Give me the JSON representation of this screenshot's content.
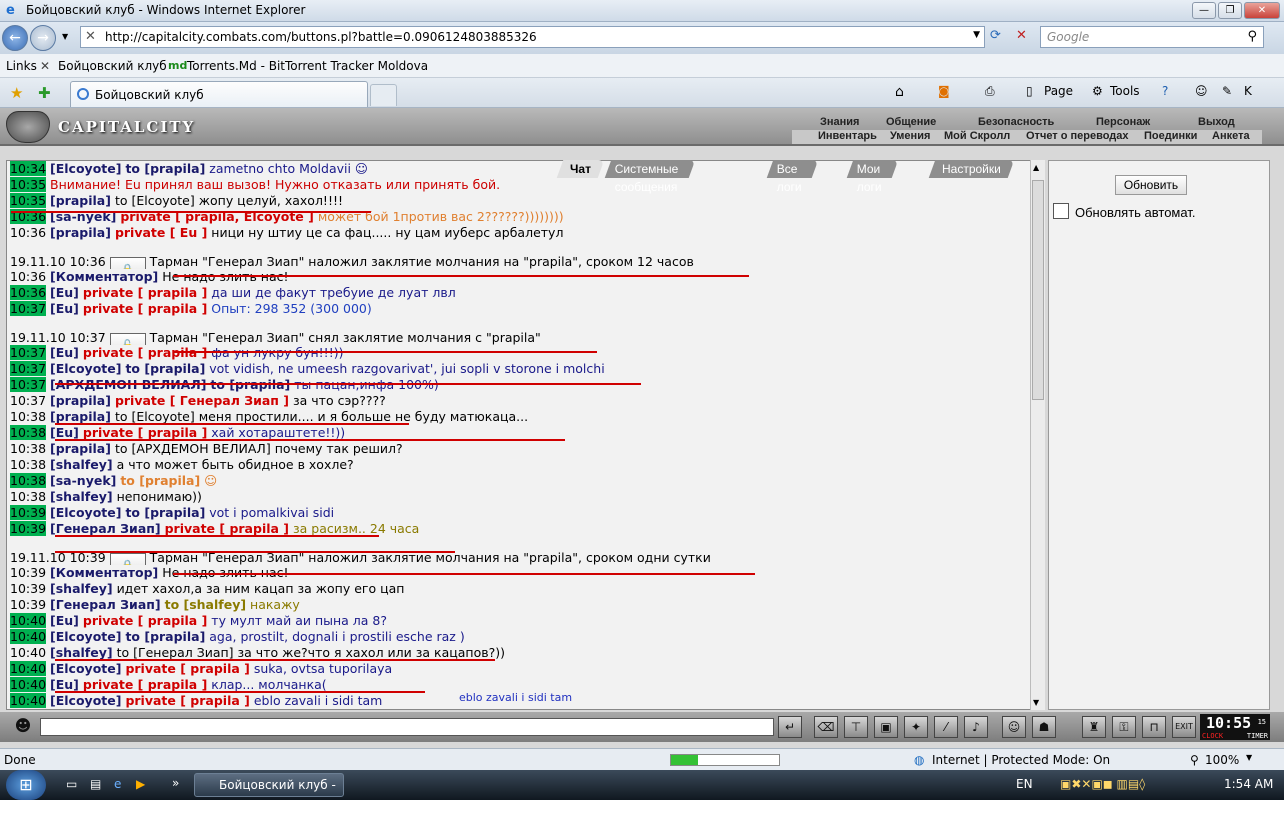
{
  "window": {
    "title": "Бойцовский клуб - Windows Internet Explorer"
  },
  "address": {
    "url": "http://capitalcity.combats.com/buttons.pl?battle=0.0906124803885326",
    "search_placeholder": "Google"
  },
  "links_bar": {
    "label": "Links",
    "items": [
      "Бойцовский клуб",
      "Torrents.Md - BitTorrent Tracker Moldova"
    ]
  },
  "tab": {
    "title": "Бойцовский клуб"
  },
  "toolbar": {
    "page": "Page",
    "tools": "Tools"
  },
  "game": {
    "logo": "CAPITALCITY",
    "menu_top": [
      "Знания",
      "Общение",
      "Безопасность",
      "Персонаж",
      "Выход"
    ],
    "menu_bottom": [
      "Инвентарь",
      "Умения",
      "Мой Скролл",
      "Отчет о переводах",
      "Поединки",
      "Анкета"
    ],
    "chat_tabs": [
      "Чат",
      "Системные сообщения",
      "Все логи",
      "Мои логи",
      "Настройки"
    ],
    "refresh_button": "Обновить",
    "auto_refresh_label": "Обновлять автомат.",
    "clock": {
      "time": "10:55",
      "sec": "15",
      "label_left": "CLOCK",
      "label_right": "TIMER"
    },
    "note": "eblo zavali i sidi tam"
  },
  "chat": [
    {
      "ts": "10:34",
      "hi": true,
      "nick": "[Elcoyote]",
      "kind": "to",
      "target": "to [prapila]",
      "text": "zametno chto Moldavii ☺",
      "tc": "blue"
    },
    {
      "ts": "10:35",
      "hi": true,
      "kind": "sys",
      "text": "Внимание! Eu принял ваш вызов! Нужно отказать или принять бой.",
      "tc": "red"
    },
    {
      "ts": "10:35",
      "hi": true,
      "nick": "[prapila]",
      "kind": "plain",
      "target": "to [Elcoyote]",
      "text": "жопу целуй, хахол!!!!",
      "tc": "msg"
    },
    {
      "ts": "10:36",
      "hi": true,
      "nick": "[sa-nyek]",
      "kind": "pv",
      "target": "private [ prapila, Elcoyote ]",
      "text": "может бой 1против вас 2??????))))))))",
      "tc": "orange"
    },
    {
      "ts": "10:36",
      "hi": false,
      "nick": "[prapila]",
      "kind": "pv",
      "target": "private [ Eu ]",
      "text": "ници ну штиу це са фац..... ну цам иуберс арбалетул",
      "tc": "msg"
    },
    {
      "ts": "19.11.10 10:36",
      "hi": false,
      "kind": "magic",
      "icon": "silence-scroll",
      "text": "Тарман \"Генерал Зиап\" наложил заклятие молчания на \"prapila\", сроком 12 часов",
      "tc": "msg"
    },
    {
      "ts": "10:36",
      "hi": false,
      "nick": "[Комментатор]",
      "kind": "plain",
      "target": "",
      "text": "Не надо злить нас!",
      "tc": "msg"
    },
    {
      "ts": "10:36",
      "hi": true,
      "nick": "[Eu]",
      "kind": "pv",
      "target": "private [ prapila ]",
      "text": "да ши де факут требуие де луат лвл",
      "tc": "blue"
    },
    {
      "ts": "10:37",
      "hi": true,
      "nick": "[Eu]",
      "kind": "pv",
      "target": "private [ prapila ]",
      "text": "Опыт: 298 352 (300 000)",
      "tc": "green"
    },
    {
      "ts": "19.11.10 10:37",
      "hi": false,
      "kind": "magic",
      "icon": "unsilence-scroll",
      "text": "Тарман \"Генерал Зиап\" снял заклятие молчания с \"prapila\"",
      "tc": "msg"
    },
    {
      "ts": "10:37",
      "hi": true,
      "nick": "[Eu]",
      "kind": "pv",
      "target": "private [ prapila ]",
      "text": "фа ун лукру бун!!!))",
      "tc": "blue"
    },
    {
      "ts": "10:37",
      "hi": true,
      "nick": "[Elcoyote]",
      "kind": "to",
      "target": "to [prapila]",
      "text": "vot vidish, ne umeesh razgovarivat', jui sopli v storone i molchi",
      "tc": "blue"
    },
    {
      "ts": "10:37",
      "hi": true,
      "nick": "[АРХДЕМОН ВЕЛИАЛ]",
      "kind": "to",
      "target": "to [prapila]",
      "text": "ты пацан,инфа 100%)",
      "tc": "blue"
    },
    {
      "ts": "10:37",
      "hi": false,
      "nick": "[prapila]",
      "kind": "pv",
      "target": "private [ Генерал Зиап ]",
      "text": "за что сэр????",
      "tc": "msg"
    },
    {
      "ts": "10:38",
      "hi": false,
      "nick": "[prapila]",
      "kind": "plain",
      "target": "to [Elcoyote]",
      "text": "меня простили.... и я больше не буду матюкаца...",
      "tc": "msg"
    },
    {
      "ts": "10:38",
      "hi": true,
      "nick": "[Eu]",
      "kind": "pv",
      "target": "private [ prapila ]",
      "text": "хай хотараштете!!))",
      "tc": "blue"
    },
    {
      "ts": "10:38",
      "hi": false,
      "nick": "[prapila]",
      "kind": "plain",
      "target": "to [АРХДЕМОН ВЕЛИАЛ]",
      "text": "почему так решил?",
      "tc": "msg"
    },
    {
      "ts": "10:38",
      "hi": false,
      "nick": "[shalfey]",
      "kind": "plain",
      "target": "",
      "text": "а что может быть обидное в хохле?",
      "tc": "msg"
    },
    {
      "ts": "10:38",
      "hi": true,
      "nick": "[sa-nyek]",
      "kind": "to",
      "target": "to [prapila]",
      "text": "☺",
      "tc": "orange"
    },
    {
      "ts": "10:38",
      "hi": false,
      "nick": "[shalfey]",
      "kind": "plain",
      "target": "",
      "text": "непонимаю))",
      "tc": "msg"
    },
    {
      "ts": "10:39",
      "hi": true,
      "nick": "[Elcoyote]",
      "kind": "to",
      "target": "to [prapila]",
      "text": "vot i pomalkivai sidi",
      "tc": "blue"
    },
    {
      "ts": "10:39",
      "hi": true,
      "nick": "[Генерал Зиап]",
      "kind": "pv",
      "target": "private [ prapila ]",
      "text": "за расизм.. 24 часа",
      "tc": "olive"
    },
    {
      "ts": "19.11.10 10:39",
      "hi": false,
      "kind": "magic",
      "icon": "silence-scroll",
      "text": "Тарман \"Генерал Зиап\" наложил заклятие молчания на \"prapila\", сроком одни сутки",
      "tc": "msg"
    },
    {
      "ts": "10:39",
      "hi": false,
      "nick": "[Комментатор]",
      "kind": "plain",
      "target": "",
      "text": "Не надо злить нас!",
      "tc": "msg"
    },
    {
      "ts": "10:39",
      "hi": false,
      "nick": "[shalfey]",
      "kind": "plain",
      "target": "",
      "text": "идет хахол,а за ним кацап за жопу его цап",
      "tc": "msg"
    },
    {
      "ts": "10:39",
      "hi": false,
      "nick": "[Генерал Зиап]",
      "kind": "to",
      "target": "to [shalfey]",
      "text": "накажу",
      "tc": "olive"
    },
    {
      "ts": "10:40",
      "hi": true,
      "nick": "[Eu]",
      "kind": "pv",
      "target": "private [ prapila ]",
      "text": "ту мулт май аи пына ла 8?",
      "tc": "blue"
    },
    {
      "ts": "10:40",
      "hi": true,
      "nick": "[Elcoyote]",
      "kind": "to",
      "target": "to [prapila]",
      "text": "aga, prostilt, dognali i prostili esche raz )",
      "tc": "blue"
    },
    {
      "ts": "10:40",
      "hi": false,
      "nick": "[shalfey]",
      "kind": "plain",
      "target": "to [Генерал Зиап]",
      "text": "за что же?что я хахол или за кацапов?))",
      "tc": "msg"
    },
    {
      "ts": "10:40",
      "hi": true,
      "nick": "[Elcoyote]",
      "kind": "pv",
      "target": "private [ prapila ]",
      "text": "suka, ovtsa tuporilaya",
      "tc": "blue"
    },
    {
      "ts": "10:40",
      "hi": true,
      "nick": "[Eu]",
      "kind": "pv",
      "target": "private [ prapila ]",
      "text": "клар... молчанка(",
      "tc": "blue"
    },
    {
      "ts": "10:40",
      "hi": true,
      "nick": "[Elcoyote]",
      "kind": "pv",
      "target": "private [ prapila ]",
      "text": "eblo zavali i sidi tam",
      "tc": "blue"
    }
  ],
  "status": {
    "left": "Done",
    "zone": "Internet | Protected Mode: On",
    "zoom": "100%",
    "progress": 0.25
  },
  "taskbar": {
    "button": "Бойцовский клуб - ...",
    "lang": "EN",
    "time": "1:54 AM"
  }
}
